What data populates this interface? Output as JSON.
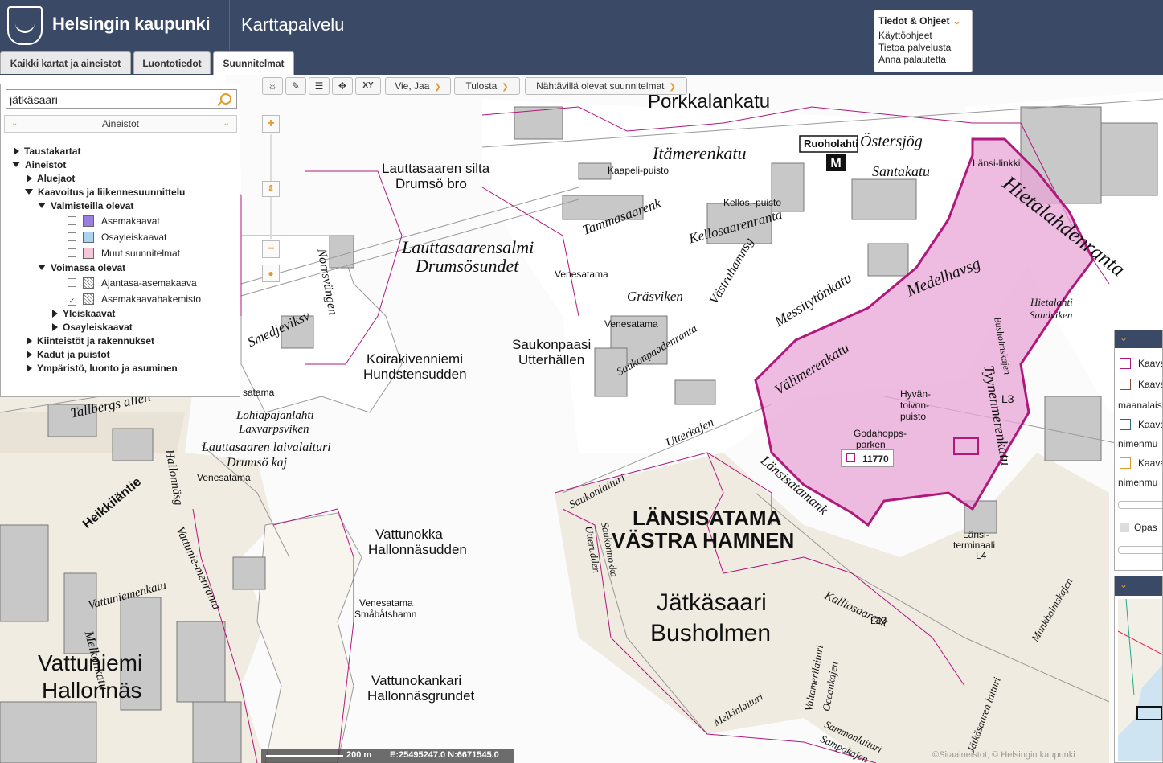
{
  "header": {
    "brand": "Helsingin kaupunki",
    "service": "Karttapalvelu",
    "info": {
      "title": "Tiedot & Ohjeet",
      "links": [
        "Käyttöohjeet",
        "Tietoa palvelusta",
        "Anna palautetta"
      ]
    }
  },
  "tabs": [
    {
      "label": "Kaikki kartat ja aineistot",
      "active": false
    },
    {
      "label": "Luontotiedot",
      "active": false
    },
    {
      "label": "Suunnitelmat",
      "active": true
    }
  ],
  "toolbar": {
    "icons": [
      "sun-icon",
      "ruler-icon",
      "list-icon",
      "move-icon",
      "xy-icon"
    ],
    "xy_label": "XY",
    "buttons": [
      "Vie, Jaa",
      "Tulosta",
      "Nähtävillä olevat suunnitelmat"
    ]
  },
  "side_panel": {
    "search_value": "jätkäsaari",
    "layers_title": "Aineistot",
    "tree": {
      "taustakartat": "Taustakartat",
      "aineistot": "Aineistot",
      "aluejaot": "Aluejaot",
      "kaavoitus": "Kaavoitus ja liikennesuunnittelu",
      "valmisteilla": "Valmisteilla olevat",
      "asemakaavat": "Asemakaavat",
      "osayleiskaavat": "Osayleiskaavat",
      "muut": "Muut suunnitelmat",
      "voimassa": "Voimassa olevat",
      "ajantasa": "Ajantasa-asemakaava",
      "kehkisto": "Asemakaavahakemisto",
      "yleiskaavat": "Yleiskaavat",
      "osayleis2": "Osayleiskaavat",
      "kiinteistot": "Kiinteistöt ja rakennukset",
      "kadut": "Kadut ja puistot",
      "ymparisto": "Ympäristö, luonto ja asuminen"
    },
    "colors": {
      "asemakaavat": "#9b7fe0",
      "osayleiskaavat": "#a8d4f0",
      "muut": "#f4c6d8"
    }
  },
  "zoom": {
    "plus": "+",
    "minus": "−"
  },
  "map": {
    "plan_id": "11770",
    "scale_label": "200 m",
    "coords": "E:25495247.0 N:6671545.0",
    "copyright": "©Sitaaineistot; © Helsingin kaupunki",
    "labels": {
      "porkkalankatu": "Porkkalankatu",
      "itamerenkatu": "Itämerenkatu",
      "lauttasaaren_silta": "Lauttasaaren silta",
      "drumso_bro": "Drumsö bro",
      "lauttasaarensalmi": "Lauttasaarensalmi",
      "drumsosundet": "Drumsösundet",
      "ruoholahti": "Ruoholahti",
      "ostersjog": "Östersjög",
      "santakatu": "Santakatu",
      "hietalahdenranta": "Hietalahdenranta",
      "tammasaarenk": "Tammasaarenk",
      "kellosaarenranta": "Kellosaarenranta",
      "venesatama": "Venesatama",
      "grasviken": "Gräsviken",
      "saukonpaasi": "Saukonpaasi",
      "utterhallen": "Utterhällen",
      "koirakivenniemi": "Koirakivenniemi",
      "hundstensudden": "Hundstensudden",
      "messitytonkatu": "Messitytönkatu",
      "medelhavsg": "Medelhavsg",
      "valimerenkatu": "Välimerenkatu",
      "tyynenmerenkatu": "Tyynenmerenkatu",
      "lansisatama": "LÄNSISATAMA",
      "vastra_hamnen": "VÄSTRA HAMNEN",
      "jatkasaari": "Jätkäsaari",
      "busholmen": "Busholmen",
      "vattunokka": "Vattunokka",
      "hallonnasudden": "Hallonnäsudden",
      "vattunokankari": "Vattunokankari",
      "hallonnasgrundet": "Hallonnäsgrundet",
      "vattuniemi": "Vattuniemi",
      "hallonnas": "Hallonnäs",
      "lauttasaaren_laivalaituri": "Lauttasaaren laivalaituri",
      "drumso_kaj": "Drumsö kaj",
      "lohiapajanlahti": "Lohiapajanlahti",
      "laxvarpsviken": "Laxvarpsviken",
      "tallbergs_allen": "Tallbergs allén",
      "saukonlaituri": "Saukonlaituri",
      "utterkajen": "Utterkajen",
      "lansisatamank": "Länsisatamank",
      "hietalahti": "Hietalahti",
      "sandviken": "Sandviken",
      "godahopps": "Godahopps-",
      "parken": "parken",
      "hyvantoivon": "Hyvän-",
      "toivon": "toivon-",
      "puisto": "puisto",
      "kalliosaarenk": "Kalliosaarenk",
      "l20": "L20",
      "lansiterminaali": "Länsi-",
      "terminaali": "terminaali",
      "l4": "L4",
      "valtamerilaituri": "Valtamerilaituri",
      "oceankajen": "Oceankajen",
      "melkinlaituri": "Melkinlaituri",
      "sammonlaituri": "Sammonlaituri",
      "sampokajen": "Sampokajen",
      "venesatama_smabats": "Venesatama",
      "smabatshamn": "Småbåtshamn",
      "norrsvangen": "Norrsvängen",
      "smedjeviksv": "Smedjeviksv",
      "vattuniemenkatu": "Vattuniemenkatu",
      "heikkilantie": "Heikkiläntie",
      "melkonkatu": "Melkonkatu",
      "vattuniemenranta": "Vattunie-menranta",
      "hallonnasg": "Hallonnäsg",
      "saukonnokka": "Saukonnokka",
      "utterudden": "Utterudden",
      "munkholmskajen": "Munkholmskajen",
      "jatkasaaren_laituri": "Jätkäsaaren laituri",
      "saukonpaadenranta": "Saukonpaadenranta",
      "vastrahamnsg": "Västrahamnsg",
      "lansi_linkki": "Länsi-linkki",
      "busholmskajen": "Busholmskajen",
      "l3": "L3",
      "kaapeli_puisto": "Kaapeli-puisto",
      "kelloso_puisto": "Kellos.-puisto",
      "venesatama2": "Venesatama",
      "venesatama3": "Venesatama",
      "venesatama4": "Venesatama",
      "satama": "satama",
      "kaav_short": "Kaava",
      "maanalais": "maanalais",
      "nimenmu": "nimenmu",
      "opas": "Opas"
    }
  }
}
